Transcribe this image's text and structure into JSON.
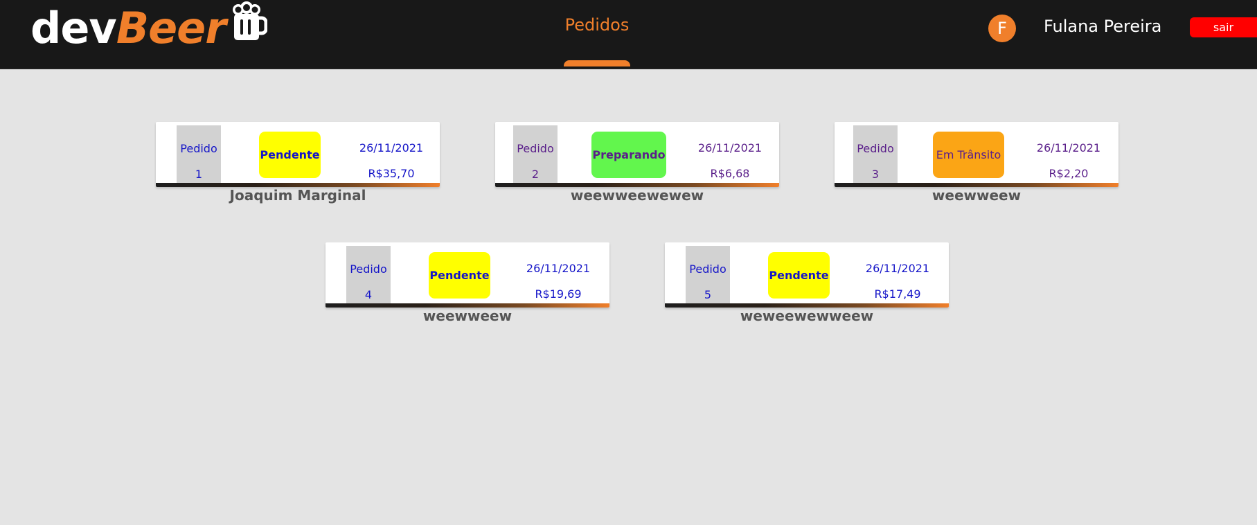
{
  "header": {
    "logo_part1": "dev",
    "logo_part2": "Beer",
    "nav_tab": "Pedidos",
    "avatar_initial": "F",
    "user_name": "Fulana Pereira",
    "logout_label": "sair"
  },
  "colors": {
    "accent": "#f07f2b",
    "header_bg": "#181818",
    "page_bg": "#e4e4e4",
    "status_pending": "#ffff00",
    "status_preparing": "#62f64d",
    "status_in_transit": "#fba515",
    "logout": "#ff0000"
  },
  "orders": [
    {
      "label": "Pedido",
      "number": "1",
      "status": "Pendente",
      "date": "26/11/2021",
      "price": "R$35,70",
      "customer": "Joaquim Marginal"
    },
    {
      "label": "Pedido",
      "number": "2",
      "status": "Preparando",
      "date": "26/11/2021",
      "price": "R$6,68",
      "customer": "weewweewewew"
    },
    {
      "label": "Pedido",
      "number": "3",
      "status": "Em Trânsito",
      "date": "26/11/2021",
      "price": "R$2,20",
      "customer": "weewweew"
    },
    {
      "label": "Pedido",
      "number": "4",
      "status": "Pendente",
      "date": "26/11/2021",
      "price": "R$19,69",
      "customer": "weewweew"
    },
    {
      "label": "Pedido",
      "number": "5",
      "status": "Pendente",
      "date": "26/11/2021",
      "price": "R$17,49",
      "customer": "weweewewweew"
    }
  ]
}
